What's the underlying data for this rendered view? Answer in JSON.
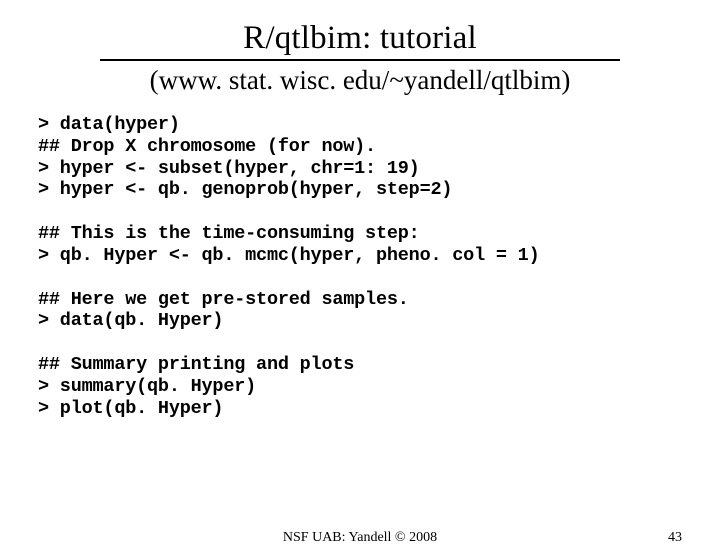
{
  "title": "R/qtlbim: tutorial",
  "subtitle": "(www. stat. wisc. edu/~yandell/qtlbim)",
  "code": "> data(hyper)\n## Drop X chromosome (for now).\n> hyper <- subset(hyper, chr=1: 19)\n> hyper <- qb. genoprob(hyper, step=2)\n\n## This is the time-consuming step:\n> qb. Hyper <- qb. mcmc(hyper, pheno. col = 1)\n\n## Here we get pre-stored samples.\n> data(qb. Hyper)\n\n## Summary printing and plots\n> summary(qb. Hyper)\n> plot(qb. Hyper)",
  "footer_center": "NSF UAB: Yandell © 2008",
  "footer_right": "43"
}
